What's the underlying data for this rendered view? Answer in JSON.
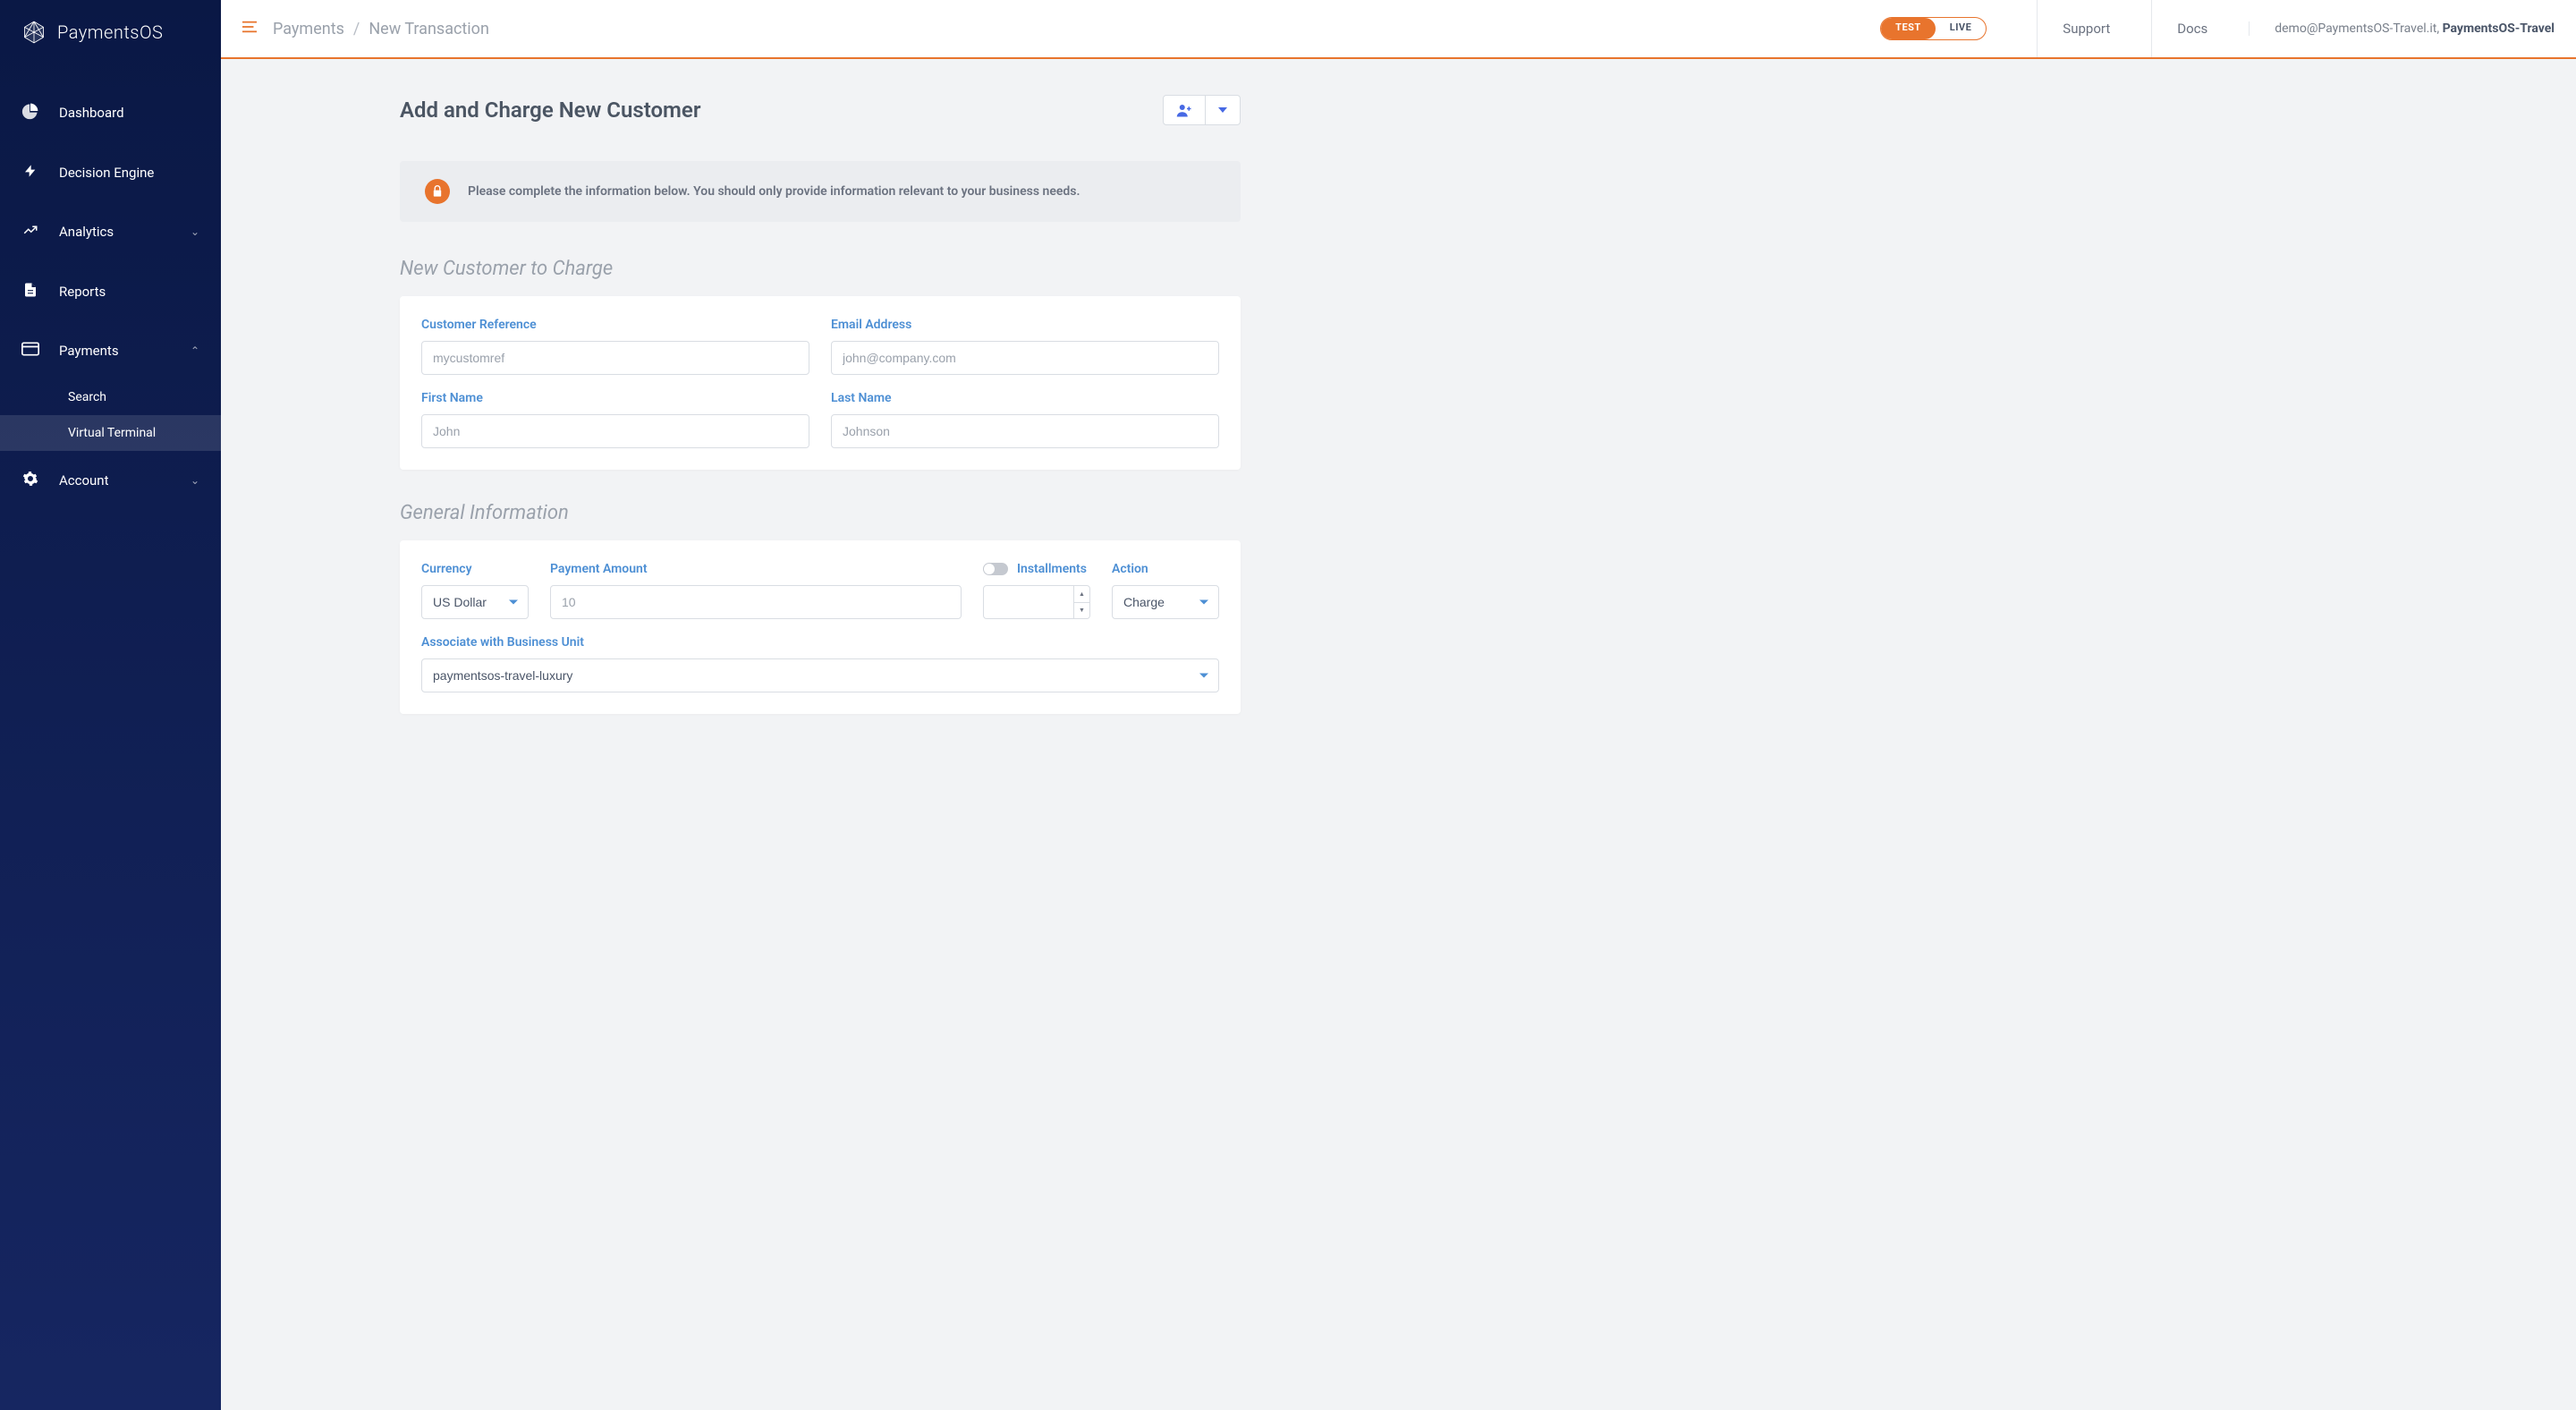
{
  "app_name": "PaymentsOS",
  "nav": {
    "dashboard": "Dashboard",
    "decision_engine": "Decision Engine",
    "analytics": "Analytics",
    "reports": "Reports",
    "payments": "Payments",
    "payments_sub": {
      "search": "Search",
      "virtual_terminal": "Virtual Terminal"
    },
    "account": "Account"
  },
  "breadcrumb": {
    "parent": "Payments",
    "current": "New Transaction"
  },
  "env_toggle": {
    "test": "TEST",
    "live": "LIVE"
  },
  "topnav": {
    "support": "Support",
    "docs": "Docs"
  },
  "user": {
    "email": "demo@PaymentsOS-Travel.it",
    "org": "PaymentsOS-Travel"
  },
  "page": {
    "title": "Add and Charge New Customer",
    "banner": "Please complete the information below. You should only provide information relevant to your business needs."
  },
  "sections": {
    "customer_title": "New Customer to Charge",
    "general_title": "General Information"
  },
  "customer_form": {
    "reference_label": "Customer Reference",
    "reference_placeholder": "mycustomref",
    "email_label": "Email Address",
    "email_placeholder": "john@company.com",
    "first_name_label": "First Name",
    "first_name_placeholder": "John",
    "last_name_label": "Last Name",
    "last_name_placeholder": "Johnson"
  },
  "general_form": {
    "currency_label": "Currency",
    "currency_value": "US Dollar",
    "amount_label": "Payment Amount",
    "amount_placeholder": "10",
    "installments_label": "Installments",
    "action_label": "Action",
    "action_value": "Charge",
    "bu_label": "Associate with Business Unit",
    "bu_value": "paymentsos-travel-luxury"
  }
}
